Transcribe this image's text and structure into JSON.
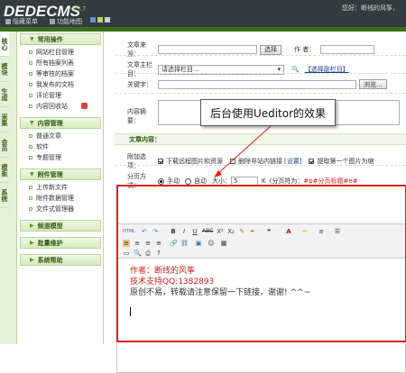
{
  "header": {
    "logo": "DEDECMS",
    "version": "v5.7",
    "welcome": "您好：断线的风筝，",
    "links": [
      "隐藏菜单",
      "功能地图"
    ]
  },
  "left_tabs": [
    "核心",
    "模块",
    "生成",
    "采集",
    "会员",
    "模板",
    "系统"
  ],
  "menu": {
    "common_ops": {
      "title": "常用操作",
      "items": [
        "网站栏目管理",
        "所有档案列表",
        "等审核的档案",
        "我发布的文档",
        "评论管理",
        "内容回收站"
      ]
    },
    "content_mgmt": {
      "title": "内容管理",
      "items": [
        "普通文章",
        "软件",
        "专题管理"
      ]
    },
    "attachments": {
      "title": "附件管理",
      "items": [
        "上传新文件",
        "附件数据管理",
        "文件式管理器"
      ]
    },
    "channel_model": {
      "title": "频道模型"
    },
    "batch": {
      "title": "批量维护"
    },
    "help": {
      "title": "系统帮助"
    }
  },
  "form": {
    "source_label": "文章来源：",
    "select_btn": "选择",
    "author_label": "作 者：",
    "column_label": "文章主栏目：",
    "column_value": "请选择栏目...",
    "sub_column_link": "【选择副栏目】",
    "keyword_label": "关键字：",
    "browse_btn": "浏览...",
    "summary_label": "内容摘要：",
    "content_section": "文章内容：",
    "attach_label": "附加选项：",
    "opt_download_remote": "下载远程图片和资源",
    "opt_remove_links": "删除非站内链接",
    "opt_settings": "[设置]",
    "opt_extract_first": "提取第一个图片为缩",
    "paging_label": "分页方式：",
    "paging_manual": "手动",
    "paging_auto": "自动",
    "size_label": "大小：",
    "size_value": "5",
    "size_unit": "K",
    "paging_marker": "(分页符为：",
    "paging_marker_code": "#p#分页标题#e#",
    ")": ")"
  },
  "editor": {
    "line1": "作者：断线的风筝",
    "line2": "技术支持QQ:1382893",
    "line3": "原创不易，转载请注意保留一下链接，谢谢! ^^~",
    "toolbar_icons": [
      "html-icon",
      "undo-icon",
      "redo-icon",
      "bold-icon",
      "italic-icon",
      "underline-icon",
      "strikethrough-icon",
      "superscript-icon",
      "subscript-icon",
      "clear-format-icon",
      "format-brush-icon",
      "quote-icon",
      "font-color-icon",
      "highlight-icon",
      "ordered-list-icon",
      "unordered-list-icon"
    ]
  },
  "callout": "后台使用Ueditor的效果",
  "colors": {
    "topbar": "#333c3f",
    "accent": "#3a6f1c",
    "highlight": "#e21c1c",
    "editor_red": "#d11a1a"
  }
}
